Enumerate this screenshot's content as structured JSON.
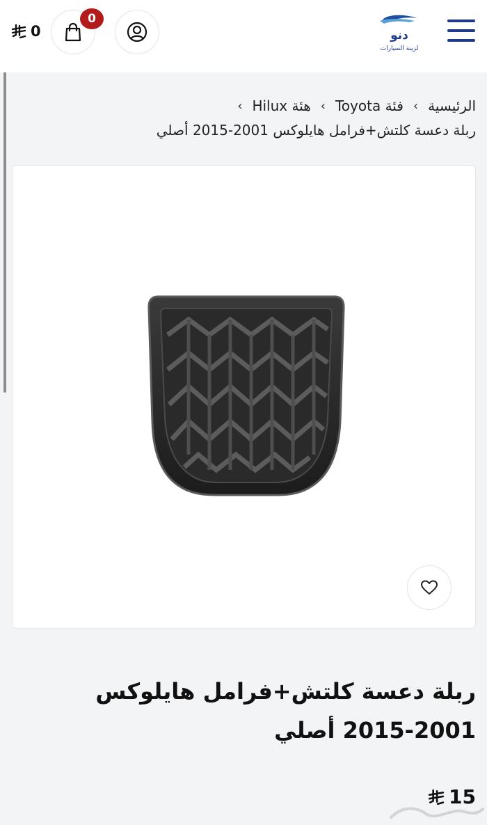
{
  "header": {
    "cart_total": "0",
    "currency_symbol": "riyal-icon",
    "cart_count": "0",
    "brand_logo": "دنو لزينة السيارات",
    "menu_icon": "hamburger-icon",
    "cart_icon": "shopping-bag-icon",
    "account_icon": "user-circle-icon"
  },
  "breadcrumb": {
    "home": "الرئيسية",
    "category": "فئة Toyota",
    "subcategory": "هئة Hilux",
    "current": "ربلة دعسة كلتش+فرامل هايلوكس 2001-2015 أصلي"
  },
  "product": {
    "title": "ربلة دعسة كلتش+فرامل هايلوكس 2001-2015 أصلي",
    "price": "15",
    "wishlist_icon": "heart-icon",
    "image": "rubber-pedal-pad"
  },
  "colors": {
    "accent": "#1e3a8a",
    "badge": "#b31b1b",
    "background": "#f3f4f6"
  }
}
